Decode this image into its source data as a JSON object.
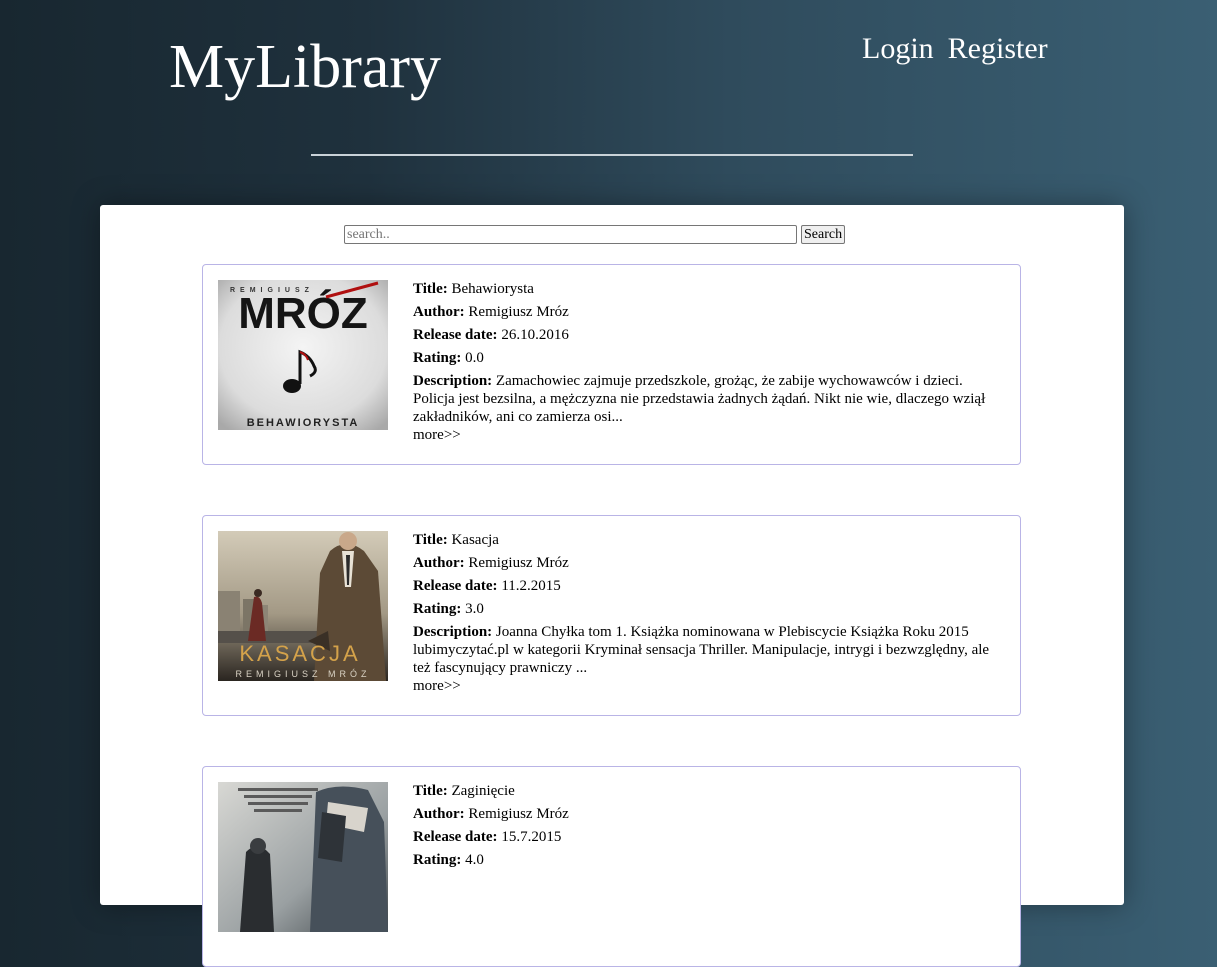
{
  "header": {
    "brand": "MyLibrary",
    "nav": {
      "login": "Login",
      "register": "Register"
    }
  },
  "search": {
    "placeholder": "search..",
    "button_label": "Search"
  },
  "labels": {
    "title": "Title:",
    "author": "Author:",
    "release_date": "Release date:",
    "rating": "Rating:",
    "description": "Description:",
    "more": "more>>"
  },
  "books": [
    {
      "title": "Behawiorysta",
      "author": "Remigiusz Mróz",
      "release_date": "26.10.2016",
      "rating": "0.0",
      "description": "Zamachowiec zajmuje przedszkole, grożąc, że zabije wychowawców i dzieci. Policja jest bezsilna, a mężczyzna nie przedstawia żadnych żądań. Nikt nie wie, dlaczego wziął zakładników, ani co zamierza osi...",
      "cover": {
        "author_line": "REMIGIUSZ",
        "big_title": "MRÓZ",
        "bottom_title": "BEHAWIORYSTA"
      }
    },
    {
      "title": "Kasacja",
      "author": "Remigiusz Mróz",
      "release_date": "11.2.2015",
      "rating": "3.0",
      "description": "Joanna Chyłka tom 1. Książka nominowana w Plebiscycie Książka Roku 2015 lubimyczytać.pl w kategorii Kryminał sensacja Thriller. Manipulacje, intrygi i bezwzględny, ale też fascynujący prawniczy ...",
      "cover": {
        "big_title": "KASACJA",
        "bottom_title": "REMIGIUSZ MRÓZ"
      }
    },
    {
      "title": "Zaginięcie",
      "author": "Remigiusz Mróz",
      "release_date": "15.7.2015",
      "rating": "4.0",
      "description": "",
      "cover": {}
    }
  ]
}
